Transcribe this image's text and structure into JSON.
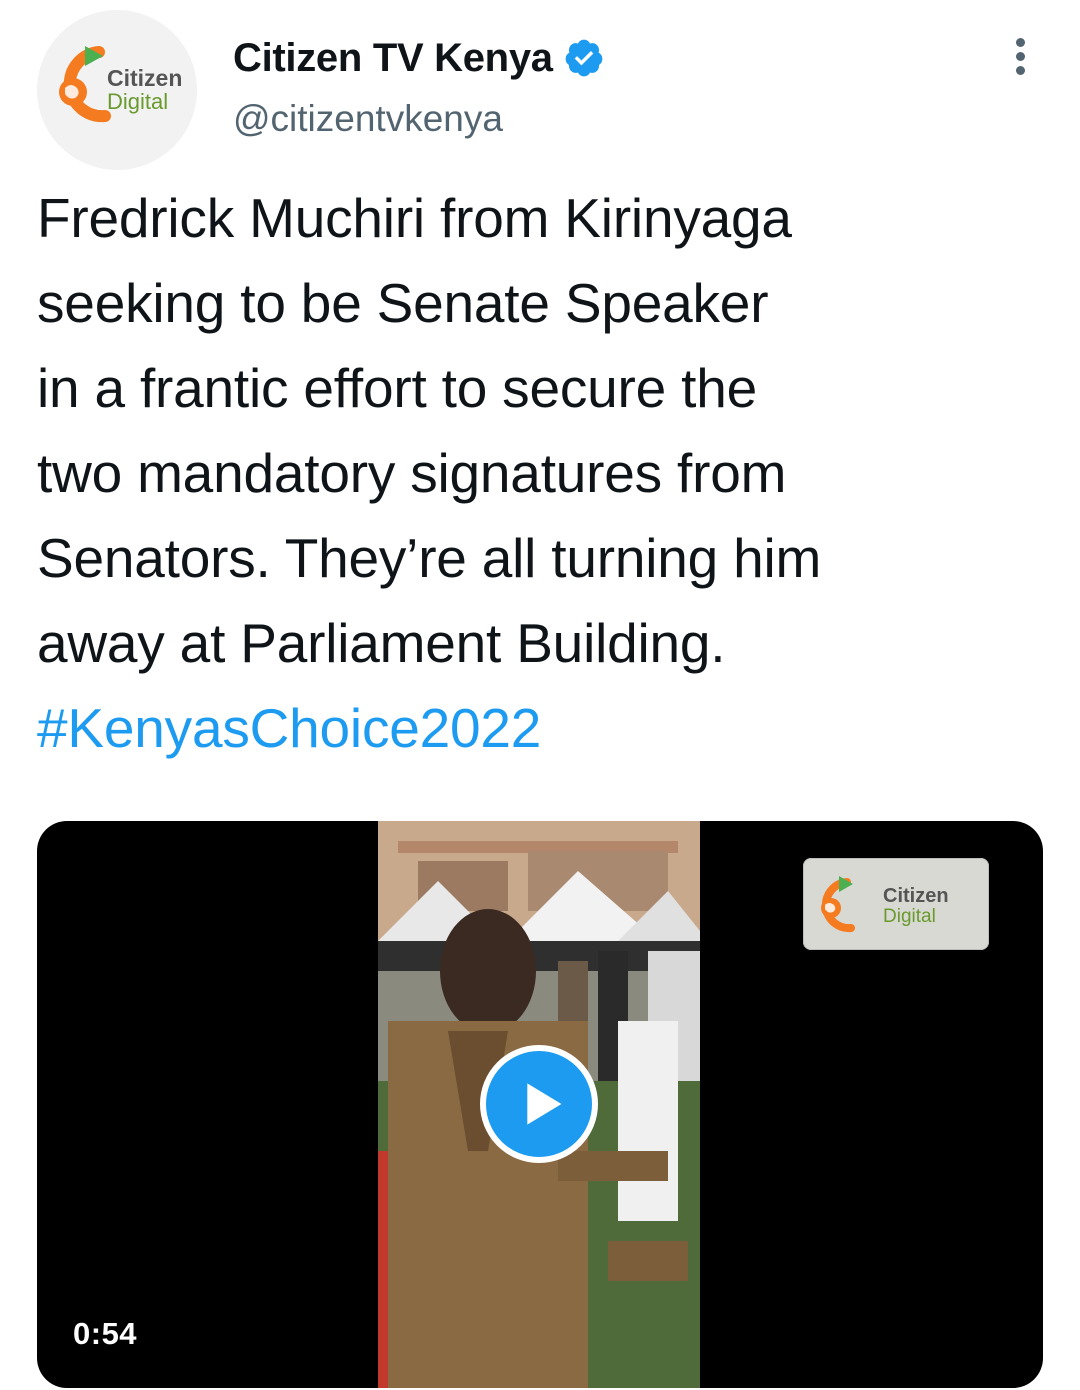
{
  "tweet": {
    "author": {
      "display_name": "Citizen TV Kenya",
      "handle": "@citizentvkenya",
      "verified": true,
      "avatar_icon": "citizen-digital-logo",
      "avatar_logo_line1": "Citizen",
      "avatar_logo_line2": "Digital"
    },
    "more_icon": "more-vertical-icon",
    "text_lines": [
      "Fredrick Muchiri from Kirinyaga",
      "seeking to be Senate Speaker",
      "in a frantic effort to secure the",
      "two mandatory signatures from",
      "Senators. They’re all turning him",
      "away at Parliament Building."
    ],
    "hashtag": "#KenyasChoice2022",
    "media": {
      "type": "video",
      "duration": "0:54",
      "play_icon": "play-icon",
      "watermark_line1": "Citizen",
      "watermark_line2": "Digital"
    }
  },
  "colors": {
    "accent": "#1d9bf0",
    "text": "#0f1419",
    "secondary_text": "#536471",
    "brand_orange": "#f47b20",
    "brand_green": "#4caf50"
  }
}
